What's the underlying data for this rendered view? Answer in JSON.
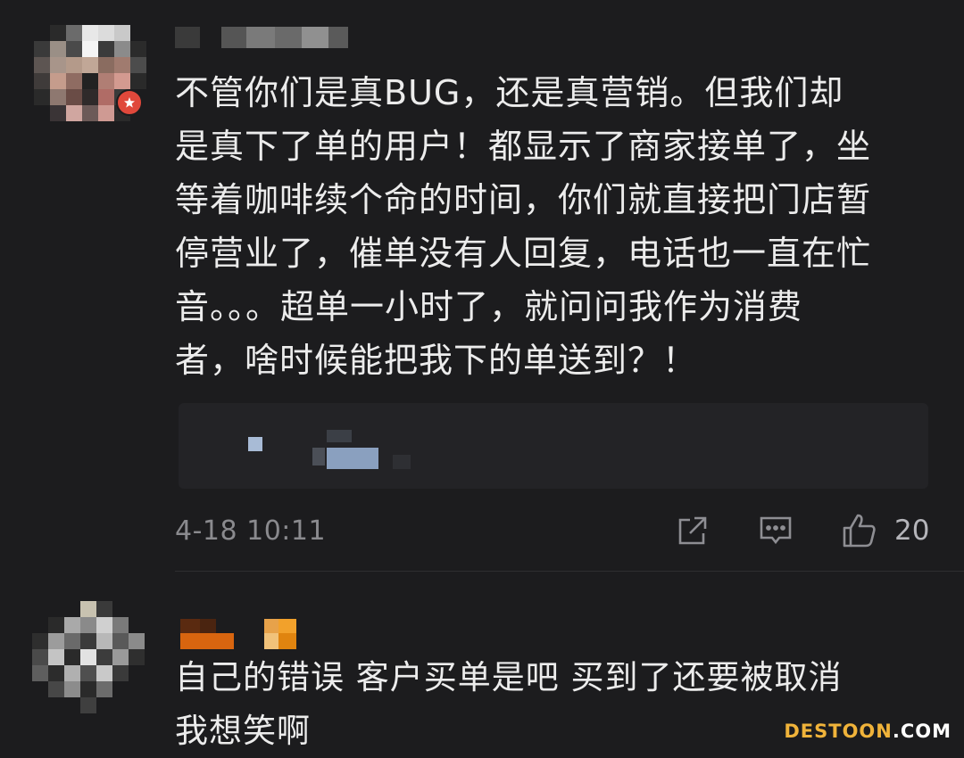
{
  "comments": [
    {
      "username": "",
      "text_lines": [
        "不管你们是真BUG，还是真营销。但我们却",
        "是真下了单的用户！都显示了商家接单了，坐",
        "等着咖啡续个命的时间，你们就直接把门店暂",
        "停营业了，催单没有人回复，电话也一直在忙",
        "音。。。超单一小时了，就问问我作为消费",
        "者，啥时候能把我下的单送到？！"
      ],
      "timestamp": "4-18 10:11",
      "like_count": "20",
      "actions": {
        "share_icon": "share-icon",
        "reply_icon": "comment-icon",
        "like_icon": "thumbs-up-icon"
      },
      "badge_color": "#e0483b"
    },
    {
      "username": "",
      "text_lines": [
        "自己的错误 客户买单是吧 买到了还要被取消",
        "我想笑啊"
      ]
    }
  ],
  "watermark": {
    "brand": "DESTOON",
    "tld": ".COM"
  },
  "colors": {
    "background": "#1c1c1e",
    "text": "#ececec",
    "meta": "#8a8a8e",
    "watermark": "#f0b33a"
  }
}
